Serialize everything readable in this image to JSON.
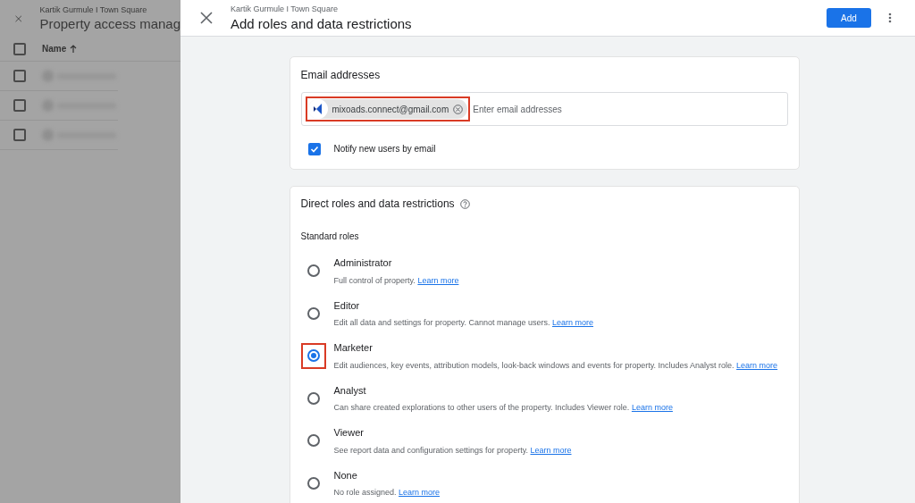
{
  "background_page": {
    "breadcrumb": "Kartik Gurmule I Town Square",
    "title": "Property access manag",
    "column_header": "Name",
    "select_all": {
      "checked": false
    },
    "rows": [
      {
        "checked": false
      },
      {
        "checked": false
      },
      {
        "checked": false
      }
    ]
  },
  "dialog": {
    "breadcrumb": "Kartik Gurmule I Town Square",
    "title": "Add roles and data restrictions",
    "add_button": "Add"
  },
  "email_card": {
    "title": "Email addresses",
    "chips": [
      {
        "email": "mixoads.connect@gmail.com",
        "highlighted": true
      }
    ],
    "placeholder": "Enter email addresses",
    "notify": {
      "label": "Notify new users by email",
      "checked": true
    }
  },
  "roles_card": {
    "title": "Direct roles and data restrictions",
    "subtitle": "Standard roles",
    "roles": [
      {
        "name": "Administrator",
        "description": "Full control of property.",
        "link": "Learn more",
        "selected": false,
        "highlighted": false
      },
      {
        "name": "Editor",
        "description": "Edit all data and settings for property. Cannot manage users.",
        "link": "Learn more",
        "selected": false,
        "highlighted": false
      },
      {
        "name": "Marketer",
        "description": "Edit audiences, key events, attribution models, look-back windows and events for property. Includes Analyst role.",
        "link": "Learn more",
        "selected": true,
        "highlighted": true
      },
      {
        "name": "Analyst",
        "description": "Can share created explorations to other users of the property. Includes Viewer role.",
        "link": "Learn more",
        "selected": false,
        "highlighted": false
      },
      {
        "name": "Viewer",
        "description": "See report data and configuration settings for property.",
        "link": "Learn more",
        "selected": false,
        "highlighted": false
      },
      {
        "name": "None",
        "description": "No role assigned.",
        "link": "Learn more",
        "selected": false,
        "highlighted": false
      }
    ]
  }
}
